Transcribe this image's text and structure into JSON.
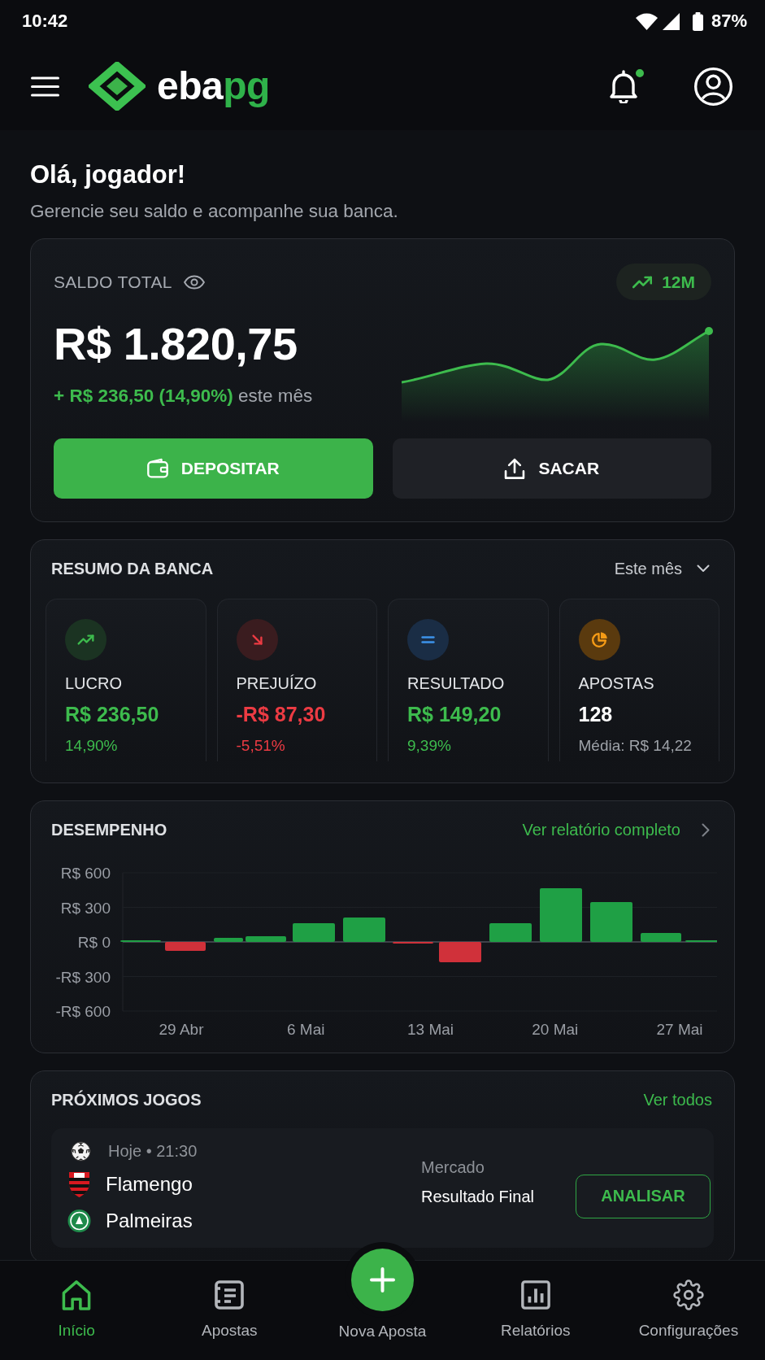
{
  "status_bar": {
    "time": "10:42",
    "battery": "87%"
  },
  "header": {
    "logo": {
      "parts": [
        {
          "text": "eba",
          "accent": false
        },
        {
          "text": "pg",
          "accent": true
        }
      ]
    },
    "notifications_unread": true
  },
  "greeting": {
    "title": "Olá, jogador!",
    "subtitle": "Gerencie seu saldo e acompanhe sua banca."
  },
  "balance": {
    "label": "SALDO TOTAL",
    "period": "12M",
    "amount": "R$ 1.820,75",
    "change": "+ R$ 236,50 (14,90%)",
    "change_suffix": "este mês",
    "actions": [
      {
        "label": "DEPOSITAR",
        "kind": "deposit"
      },
      {
        "label": "SACAR",
        "kind": "withdraw"
      }
    ]
  },
  "summary": {
    "title": "RESUMO DA BANCA",
    "period": "Este mês",
    "stats": [
      {
        "kind": "profit",
        "label": "LUCRO",
        "value": "R$ 236,50",
        "detail": "14,90%"
      },
      {
        "kind": "loss",
        "label": "PREJUÍZO",
        "value": "-R$ 87,30",
        "detail": "-5,51%"
      },
      {
        "kind": "result",
        "label": "RESULTADO",
        "value": "R$ 149,20",
        "detail": "9,39%"
      },
      {
        "kind": "bets",
        "label": "APOSTAS",
        "value": "128",
        "detail": "Média: R$ 14,22"
      }
    ]
  },
  "performance": {
    "title": "DESEMPENHO",
    "link": "Ver relatório completo",
    "y_axis_labels": [
      "R$ 600",
      "R$ 300",
      "R$ 0",
      "-R$ 300",
      "-R$ 600"
    ],
    "x_axis_labels": [
      "29 Abr",
      "6 Mai",
      "13 Mai",
      "20 Mai",
      "27 Mai"
    ]
  },
  "upcoming": {
    "title": "PRÓXIMOS JOGOS",
    "link": "Ver todos",
    "games": [
      {
        "time": "Hoje • 21:30",
        "home": "Flamengo",
        "away": "Palmeiras",
        "market_label": "Mercado",
        "market": "Resultado Final",
        "action": "ANALISAR"
      }
    ]
  },
  "bottom_nav": {
    "items": [
      {
        "label": "Início",
        "kind": "home",
        "selected": true
      },
      {
        "label": "Apostas",
        "kind": "bets",
        "selected": false
      },
      {
        "label": "Nova Aposta",
        "kind": "add",
        "selected": false
      },
      {
        "label": "Relatórios",
        "kind": "reports",
        "selected": false
      },
      {
        "label": "Configurações",
        "kind": "settings",
        "selected": false
      }
    ]
  }
}
